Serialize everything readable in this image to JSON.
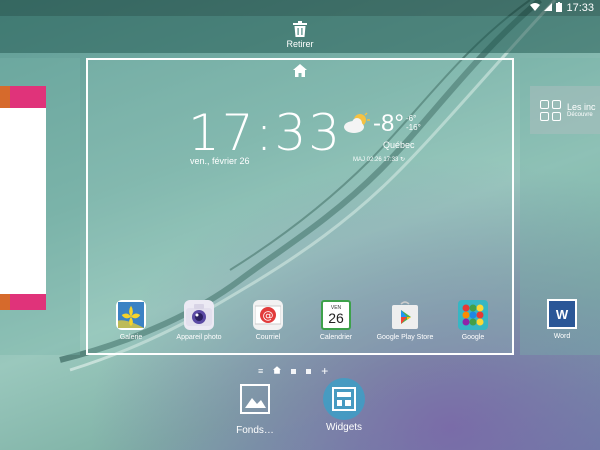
{
  "status_bar": {
    "time": "17:33"
  },
  "remove_bar": {
    "label": "Retirer"
  },
  "right_panel": {
    "widget_title": "Les inc",
    "widget_subtitle": "Découvre",
    "app_label": "Word",
    "app_icon_text": "W"
  },
  "home_page": {
    "clock": "17:33",
    "date": "ven., février 26",
    "weather": {
      "temperature": "-8°",
      "high": "-6°",
      "low": "-16°",
      "city": "Québec",
      "updated": "MAJ 02.26 17:33"
    },
    "apps": [
      {
        "label": "Galerie",
        "icon": "gallery-icon"
      },
      {
        "label": "Appareil photo",
        "icon": "camera-icon"
      },
      {
        "label": "Courriel",
        "icon": "email-icon"
      },
      {
        "label": "Calendrier",
        "icon": "calendar-icon",
        "day": "26",
        "day_name": "VEN"
      },
      {
        "label": "Google Play Store",
        "icon": "play-store-icon"
      },
      {
        "label": "Google",
        "icon": "google-folder-icon"
      }
    ]
  },
  "page_indicator": {
    "current_page": 1,
    "total_pages": 3
  },
  "bottom_actions": {
    "wallpapers_label": "Fonds…",
    "widgets_label": "Widgets"
  },
  "colors": {
    "accent_highlight": "#3aa0c8",
    "left_card": "#e0337a",
    "word_blue": "#2b5797"
  }
}
